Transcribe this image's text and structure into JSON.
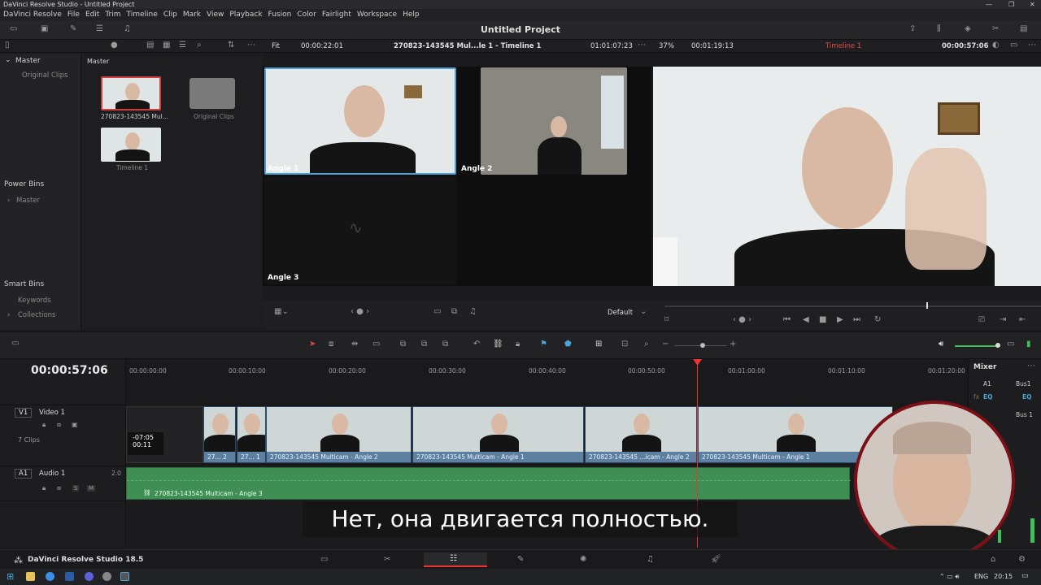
{
  "app": {
    "window_title": "DaVinci Resolve Studio - Untitled Project",
    "project_title": "Untitled Project",
    "brand": "DaVinci Resolve Studio 18.5"
  },
  "menu": [
    "DaVinci Resolve",
    "File",
    "Edit",
    "Trim",
    "Timeline",
    "Clip",
    "Mark",
    "View",
    "Playback",
    "Fusion",
    "Color",
    "Fairlight",
    "Workspace",
    "Help"
  ],
  "viewer_bar": {
    "fit": "Fit",
    "source_tc": "00:00:22:01",
    "source_name": "270823-143545 Mul...le 1 - Timeline 1",
    "source_duration": "01:01:07:23",
    "zoom": "37%",
    "program_tc": "00:01:19:13",
    "timeline_name": "Timeline 1",
    "program_position": "00:00:57:06"
  },
  "media_pool": {
    "master_label": "Master",
    "original_clips": "Original Clips",
    "power_bins": "Power Bins",
    "power_master": "Master",
    "smart_bins": "Smart Bins",
    "keywords": "Keywords",
    "collections": "Collections",
    "bin_header": "Master",
    "clip1_name": "270823-143545 Mul...",
    "folder_name": "Original Clips",
    "clip2_name": "Timeline 1"
  },
  "multicam": {
    "angle1": "Angle 1",
    "angle2": "Angle 2",
    "angle3": "Angle 3",
    "default": "Default"
  },
  "timeline": {
    "timecode": "00:00:57:06",
    "ruler": [
      "00:00:00:00",
      "00:00:10:00",
      "00:00:20:00",
      "00:00:30:00",
      "00:00:40:00",
      "00:00:50:00",
      "00:01:00:00",
      "00:01:10:00",
      "00:01:20:00"
    ],
    "v1_label": "V1",
    "v1_name": "Video 1",
    "v1_clips": "7 Clips",
    "a1_label": "A1",
    "a1_name": "Audio 1",
    "a1_level": "2.0",
    "trim_offset": "-07:05",
    "trim_duration": "00:11",
    "clips": [
      {
        "label": "27... 2"
      },
      {
        "label": "27... 1"
      },
      {
        "label": "270823-143545 Multicam - Angle 2"
      },
      {
        "label": "270823-143545 Multicam - Angle 1"
      },
      {
        "label": "270823-143545 ...icam - Angle 2"
      },
      {
        "label": "270823-143545 Multicam - Angle 1"
      }
    ],
    "audio_clip": "270823-143545 Multicam - Angle 3"
  },
  "mixer": {
    "title": "Mixer",
    "a1": "A1",
    "bus1": "Bus1",
    "eq": "EQ",
    "bus1_b": "Bus 1"
  },
  "subtitle": "Нет, она двигается полностью.",
  "taskbar": {
    "lang": "ENG",
    "time": "20:15"
  },
  "colors": {
    "accent": "#4aa3d8",
    "clip_video": "#5d7fa0",
    "clip_audio": "#3f8f55",
    "playhead": "#e33333",
    "webcam_border": "#7a0f16"
  }
}
